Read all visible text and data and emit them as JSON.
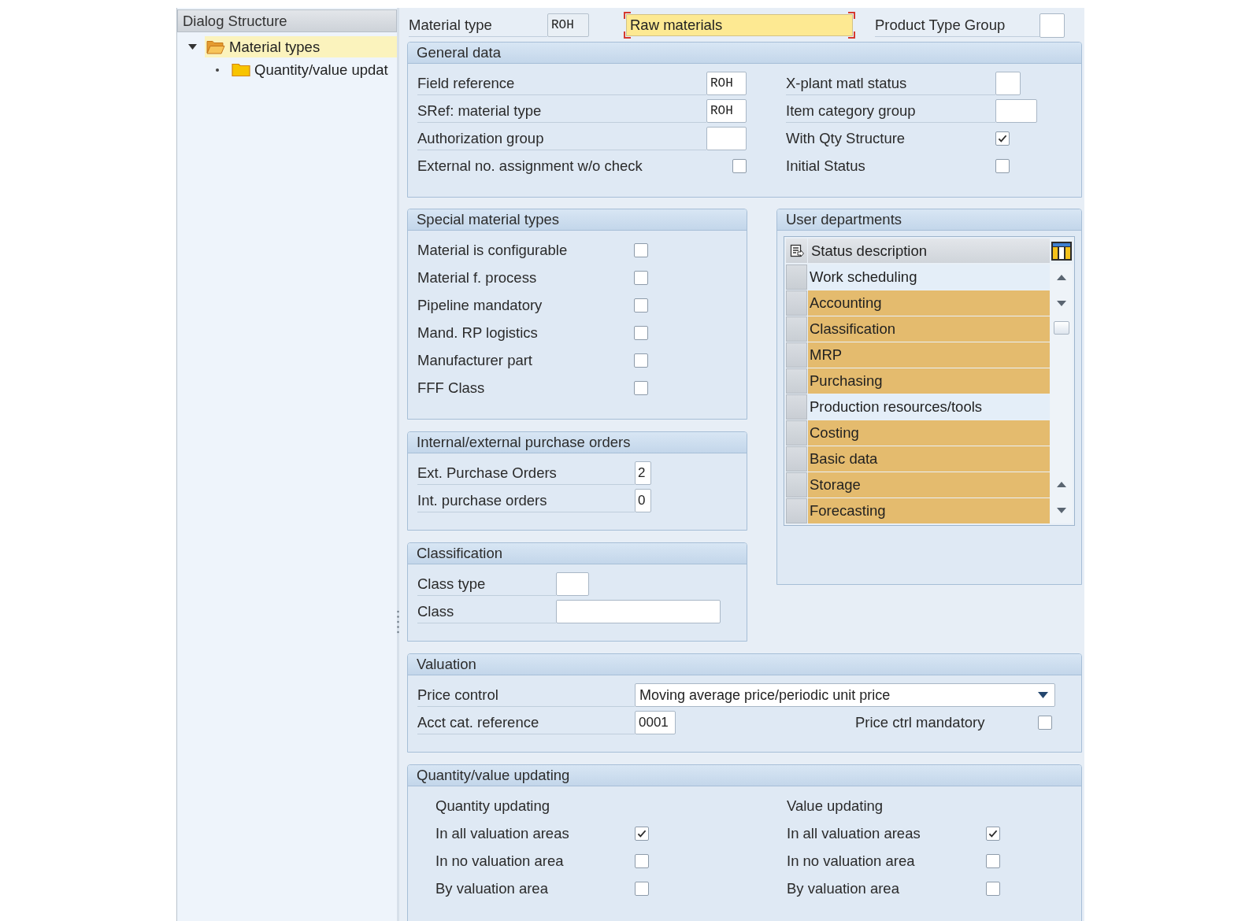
{
  "dialog_structure": {
    "title": "Dialog Structure",
    "tree": [
      {
        "label": "Material types",
        "expanded": true,
        "selected": true,
        "children": [
          {
            "label": "Quantity/value updat",
            "selected": false
          }
        ]
      }
    ]
  },
  "header": {
    "material_type": {
      "label": "Material type",
      "value": "ROH",
      "readonly": true
    },
    "description": {
      "value": "Raw materials",
      "focused": true
    },
    "product_type_group": {
      "label": "Product Type Group"
    }
  },
  "general_data": {
    "title": "General data",
    "left": [
      {
        "kind": "field",
        "label": "Field reference",
        "value": "ROH"
      },
      {
        "kind": "field",
        "label": "SRef: material type",
        "value": "ROH"
      },
      {
        "kind": "field",
        "label": "Authorization group"
      },
      {
        "kind": "checkbox",
        "label": "External no. assignment w/o check",
        "checked": false
      }
    ],
    "right": [
      {
        "kind": "field",
        "label": "X-plant matl status"
      },
      {
        "kind": "field",
        "label": "Item category group"
      },
      {
        "kind": "checkbox",
        "label": "With Qty Structure",
        "checked": true
      },
      {
        "kind": "checkbox",
        "label": "Initial Status",
        "checked": false
      }
    ]
  },
  "special_material_types": {
    "title": "Special material types",
    "items": [
      {
        "label": "Material is configurable",
        "checked": false
      },
      {
        "label": "Material f. process",
        "checked": false
      },
      {
        "label": "Pipeline mandatory",
        "checked": false
      },
      {
        "label": "Mand. RP logistics",
        "checked": false
      },
      {
        "label": "Manufacturer part",
        "checked": false
      },
      {
        "label": "FFF Class",
        "checked": false
      }
    ]
  },
  "purchase_orders": {
    "title": "Internal/external purchase orders",
    "fields": [
      {
        "label": "Ext. Purchase Orders",
        "value": "2"
      },
      {
        "label": "Int. purchase orders",
        "value": "0"
      }
    ]
  },
  "classification": {
    "title": "Classification",
    "fields": [
      {
        "label": "Class type"
      },
      {
        "label": "Class"
      }
    ]
  },
  "user_departments": {
    "title": "User departments",
    "table": {
      "column": "Status description",
      "rows": [
        {
          "label": "Work scheduling",
          "selected": false
        },
        {
          "label": "Accounting",
          "selected": true
        },
        {
          "label": "Classification",
          "selected": true
        },
        {
          "label": "MRP",
          "selected": true
        },
        {
          "label": "Purchasing",
          "selected": true
        },
        {
          "label": "Production resources/tools",
          "selected": false
        },
        {
          "label": "Costing",
          "selected": true
        },
        {
          "label": "Basic data",
          "selected": true
        },
        {
          "label": "Storage",
          "selected": true
        },
        {
          "label": "Forecasting",
          "selected": true
        }
      ]
    }
  },
  "valuation": {
    "title": "Valuation",
    "items": [
      {
        "kind": "dropdown",
        "label": "Price control",
        "value": "Moving average price/periodic unit price"
      },
      {
        "kind": "field",
        "label": "Acct cat. reference",
        "value": "0001"
      },
      {
        "kind": "checkbox",
        "label": "Price ctrl mandatory",
        "checked": false
      }
    ]
  },
  "quantity_value_updating": {
    "title": "Quantity/value updating",
    "groups": [
      {
        "title": "Quantity updating",
        "options": [
          {
            "label": "In all valuation areas",
            "checked": true
          },
          {
            "label": "In no valuation area",
            "checked": false
          },
          {
            "label": "By valuation area",
            "checked": false
          }
        ]
      },
      {
        "title": "Value updating",
        "options": [
          {
            "label": "In all valuation areas",
            "checked": true
          },
          {
            "label": "In no valuation area",
            "checked": false
          },
          {
            "label": "By valuation area",
            "checked": false
          }
        ]
      }
    ]
  }
}
